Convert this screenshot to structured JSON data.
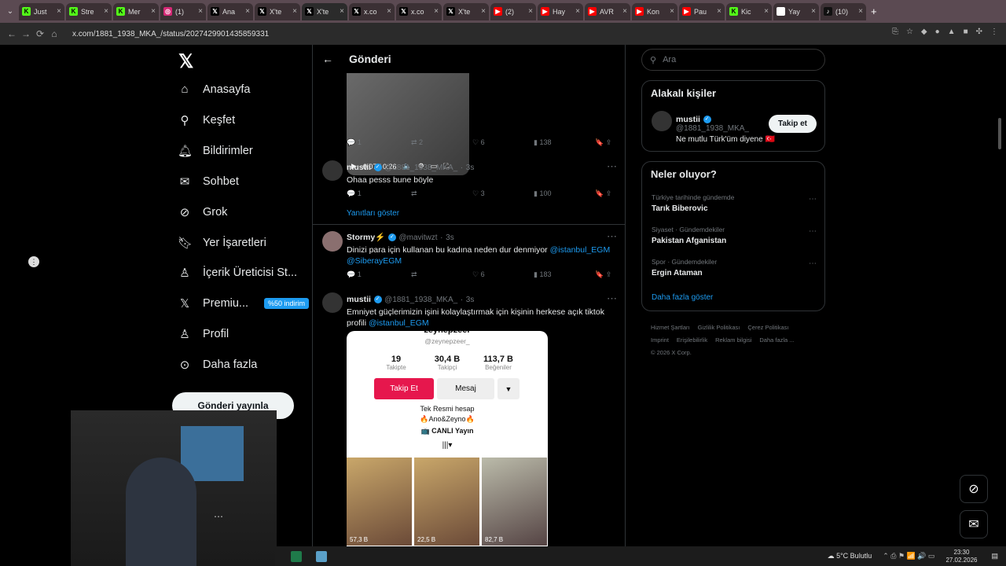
{
  "browser": {
    "tabs": [
      {
        "label": "Just",
        "icon": "kick-icon"
      },
      {
        "label": "Stre",
        "icon": "kick-icon"
      },
      {
        "label": "Mer",
        "icon": "kick-icon"
      },
      {
        "label": "(1)",
        "icon": "instagram-icon"
      },
      {
        "label": "Ana",
        "icon": "x-icon"
      },
      {
        "label": "X'te",
        "icon": "x-icon"
      },
      {
        "label": "X'te",
        "icon": "x-icon",
        "active": true
      },
      {
        "label": "x.co",
        "icon": "x-icon"
      },
      {
        "label": "x.co",
        "icon": "x-icon"
      },
      {
        "label": "X'te",
        "icon": "x-icon"
      },
      {
        "label": "(2)",
        "icon": "youtube-icon"
      },
      {
        "label": "Hay",
        "icon": "youtube-icon"
      },
      {
        "label": "AVR",
        "icon": "youtube-icon"
      },
      {
        "label": "Kon",
        "icon": "youtube-icon"
      },
      {
        "label": "Pau",
        "icon": "youtube-icon"
      },
      {
        "label": "Kic",
        "icon": "kick-icon"
      },
      {
        "label": "Yay",
        "icon": "app-icon"
      },
      {
        "label": "(10)",
        "icon": "tiktok-icon"
      }
    ],
    "url": "x.com/1881_1938_MKA_/status/2027429901435859331"
  },
  "sidebar": {
    "items": [
      {
        "label": "Anasayfa",
        "icon": "home-icon"
      },
      {
        "label": "Keşfet",
        "icon": "search-icon"
      },
      {
        "label": "Bildirimler",
        "icon": "bell-icon"
      },
      {
        "label": "Sohbet",
        "icon": "mail-icon"
      },
      {
        "label": "Grok",
        "icon": "grok-icon"
      },
      {
        "label": "Yer İşaretleri",
        "icon": "bookmark-icon"
      },
      {
        "label": "İçerik Üreticisi St...",
        "icon": "creator-icon"
      },
      {
        "label": "Premiu...",
        "icon": "x-icon"
      },
      {
        "label": "Profil",
        "icon": "person-icon"
      },
      {
        "label": "Daha fazla",
        "icon": "more-circle-icon"
      }
    ],
    "premium_badge": "%50 indirim",
    "post_button": "Gönderi yayınla"
  },
  "main": {
    "title": "Gönderi",
    "video": {
      "time": "0:07 / 0:26"
    },
    "top_actions": {
      "replies": "1",
      "reposts": "2",
      "likes": "6",
      "views": "138"
    },
    "tweets": [
      {
        "name": "mustii",
        "handle": "@1881_1938_MKA_",
        "time": "3s",
        "text": "Ohaa pesss bune böyle",
        "replies": "1",
        "reposts": "",
        "likes": "3",
        "views": "100",
        "show_replies": "Yanıtları göster"
      },
      {
        "name": "Stormy⚡",
        "handle": "@mavitwzt",
        "time": "3s",
        "text": "Dinizi para için kullanan bu kadına neden dur denmiyor",
        "mention1": "@istanbul_EGM",
        "mention2": "@SiberayEGM",
        "replies": "1",
        "reposts": "",
        "likes": "6",
        "views": "183"
      },
      {
        "name": "mustii",
        "handle": "@1881_1938_MKA_",
        "time": "3s",
        "text": "Emniyet güçlerimizin işini kolaylaştırmak için kişinin herkese açık tiktok profili",
        "mention1": "@istanbul_EGM"
      }
    ],
    "embed": {
      "username": "zeynepzeer",
      "handle": "@zeynepzeer_",
      "stats": [
        {
          "value": "19",
          "label": "Takipte"
        },
        {
          "value": "30,4 B",
          "label": "Takipçi"
        },
        {
          "value": "113,7 B",
          "label": "Beğeniler"
        }
      ],
      "follow": "Takip Et",
      "message": "Mesaj",
      "bio1": "Tek Resmi hesap",
      "bio2": "🔥Ano&Zeyno🔥",
      "live": "CANLI Yayın",
      "views": [
        "57,3 B",
        "22,5 B",
        "82,7 B"
      ]
    }
  },
  "right": {
    "search_placeholder": "Ara",
    "related_title": "Alakalı kişiler",
    "related": {
      "name": "mustii",
      "handle": "@1881_1938_MKA_",
      "bio": "Ne mutlu Türk'üm diyene 🇹🇷",
      "follow": "Takip et"
    },
    "trends_title": "Neler oluyor?",
    "trends": [
      {
        "context": "Türkiye tarihinde gündemde",
        "name": "Tarık Biberovic"
      },
      {
        "context": "Siyaset · Gündemdekiler",
        "name": "Pakistan Afganistan"
      },
      {
        "context": "Spor · Gündemdekiler",
        "name": "Ergin Ataman"
      }
    ],
    "more": "Daha fazla göster",
    "footer": [
      "Hizmet Şartları",
      "Gizlilik Politikası",
      "Çerez Politikası",
      "Imprint",
      "Erişilebilirlik",
      "Reklam bilgisi",
      "Daha fazla ...",
      "© 2026 X Corp."
    ]
  },
  "taskbar": {
    "weather": "5°C  Bulutlu",
    "time": "23:30",
    "date": "27.02.2026"
  }
}
